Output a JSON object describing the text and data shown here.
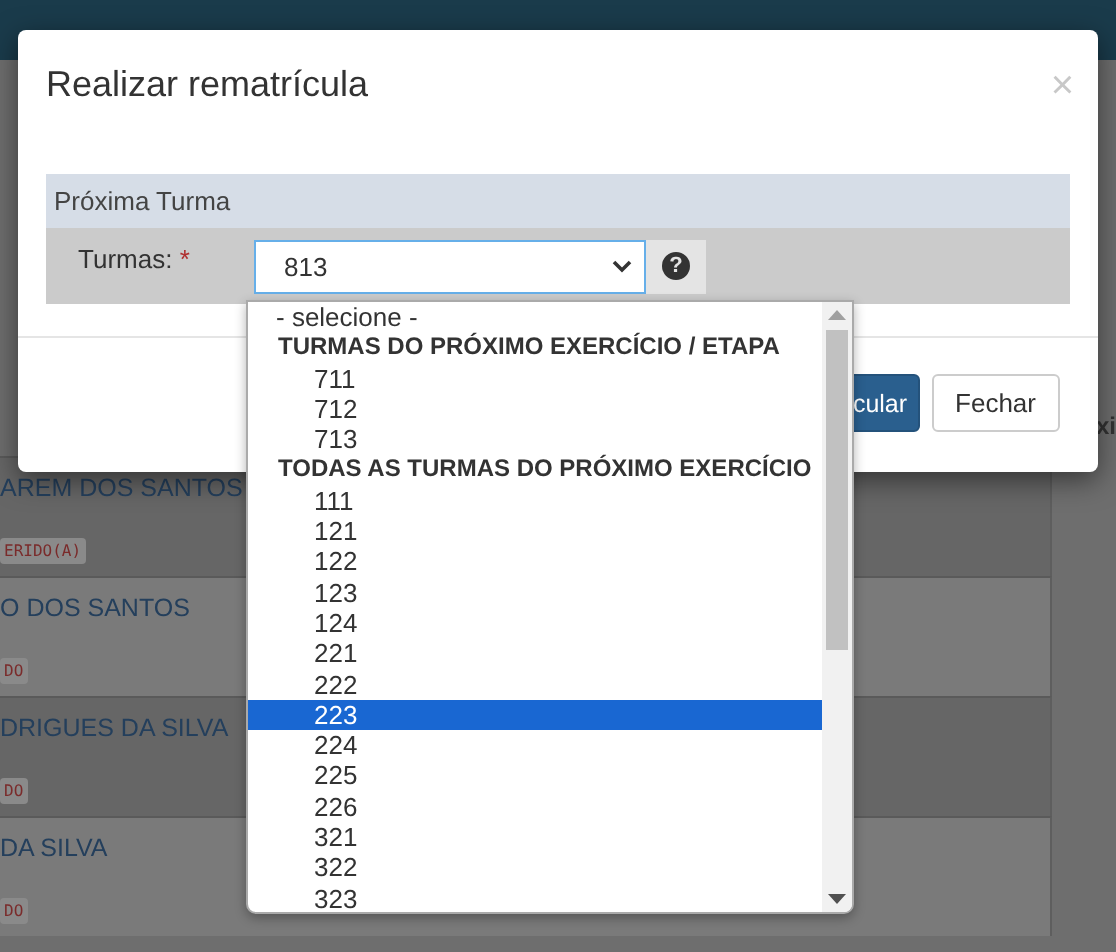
{
  "background": {
    "column_fragment": "xi",
    "rows": [
      {
        "name": "AREM DOS SANTOS",
        "badge": "ERIDO(A)"
      },
      {
        "name": "O DOS SANTOS",
        "badge": "DO"
      },
      {
        "name": "DRIGUES DA SILVA",
        "badge": "DO"
      },
      {
        "name": "DA SILVA",
        "badge": "DO"
      }
    ]
  },
  "modal": {
    "title": "Realizar rematrícula",
    "close": "×",
    "section": "Próxima Turma",
    "field": {
      "label": "Turmas:",
      "required": "*",
      "value": "813",
      "help": "?"
    },
    "buttons": [
      {
        "label": "cular",
        "kind": "primary"
      },
      {
        "label": "Fechar",
        "kind": "default"
      }
    ]
  },
  "dropdown": {
    "options": [
      {
        "kind": "placeholder",
        "label": "- selecione -",
        "selected": false
      },
      {
        "kind": "group",
        "label": "TURMAS DO PRÓXIMO EXERCÍCIO / ETAPA",
        "selected": false
      },
      {
        "kind": "option",
        "label": "711",
        "selected": false
      },
      {
        "kind": "option",
        "label": "712",
        "selected": false
      },
      {
        "kind": "option",
        "label": "713",
        "selected": false
      },
      {
        "kind": "group",
        "label": "TODAS AS TURMAS DO PRÓXIMO EXERCÍCIO",
        "selected": false
      },
      {
        "kind": "option",
        "label": "111",
        "selected": false
      },
      {
        "kind": "option",
        "label": "121",
        "selected": false
      },
      {
        "kind": "option",
        "label": "122",
        "selected": false
      },
      {
        "kind": "option",
        "label": "123",
        "selected": false
      },
      {
        "kind": "option",
        "label": "124",
        "selected": false
      },
      {
        "kind": "option",
        "label": "221",
        "selected": false
      },
      {
        "kind": "option",
        "label": "222",
        "selected": false
      },
      {
        "kind": "option",
        "label": "223",
        "selected": true
      },
      {
        "kind": "option",
        "label": "224",
        "selected": false
      },
      {
        "kind": "option",
        "label": "225",
        "selected": false
      },
      {
        "kind": "option",
        "label": "226",
        "selected": false
      },
      {
        "kind": "option",
        "label": "321",
        "selected": false
      },
      {
        "kind": "option",
        "label": "322",
        "selected": false
      },
      {
        "kind": "option",
        "label": "323",
        "selected": false
      }
    ]
  }
}
